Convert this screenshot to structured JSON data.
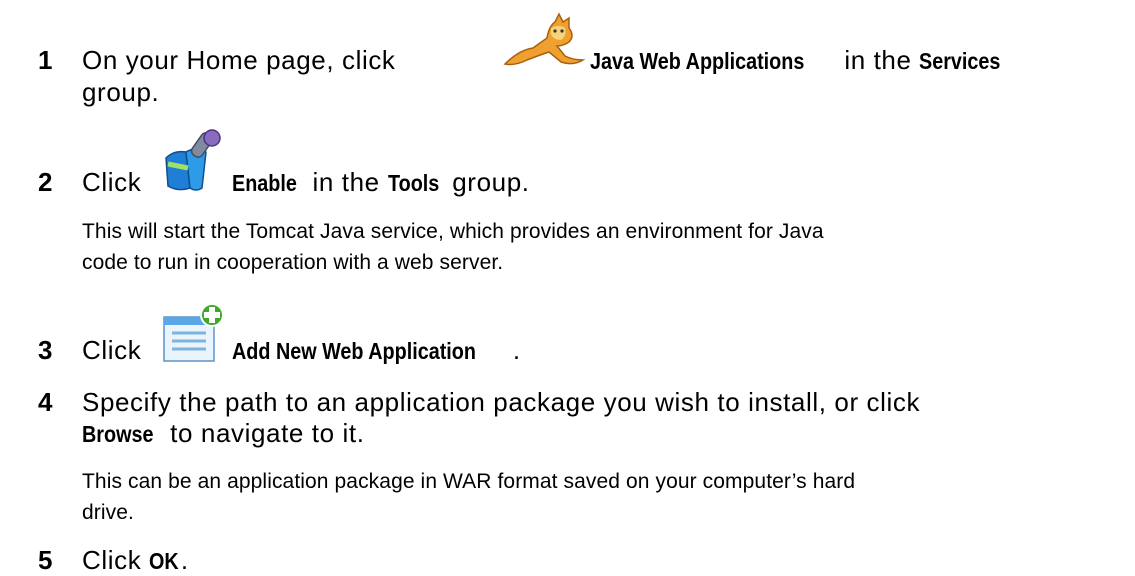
{
  "steps": [
    {
      "number": "1",
      "line1_pre": "On your Home page, click",
      "line1_bold": "Java Web Applications",
      "line1_mid": "in the",
      "line1_bold2": "Services",
      "line2": "group.",
      "icon": "tomcat-cat-icon"
    },
    {
      "number": "2",
      "pre": "Click",
      "bold": "Enable",
      "mid": "in the",
      "bold2": "Tools",
      "post": "group.",
      "icon": "java-enable-icon",
      "note_line1": "This will start the Tomcat Java service, which provides an environment for Java",
      "note_line2": "code to run in cooperation with a web server."
    },
    {
      "number": "3",
      "pre": "Click",
      "bold": "Add New Web Application",
      "post": ".",
      "icon": "add-web-app-icon"
    },
    {
      "number": "4",
      "line1": "Specify the path to an application package you wish to install, or click",
      "line2_bold": "Browse",
      "line2_post": "to navigate to it.",
      "note_line1": "This can be an application package in WAR format saved on your computer’s hard",
      "note_line2": "drive."
    },
    {
      "number": "5",
      "pre": "Click",
      "bold": "OK",
      "post": "."
    }
  ],
  "colors": {
    "text": "#000000",
    "cat_orange": "#f0a030",
    "java_blue": "#1f7fd6",
    "plus_green": "#3faa2a"
  }
}
